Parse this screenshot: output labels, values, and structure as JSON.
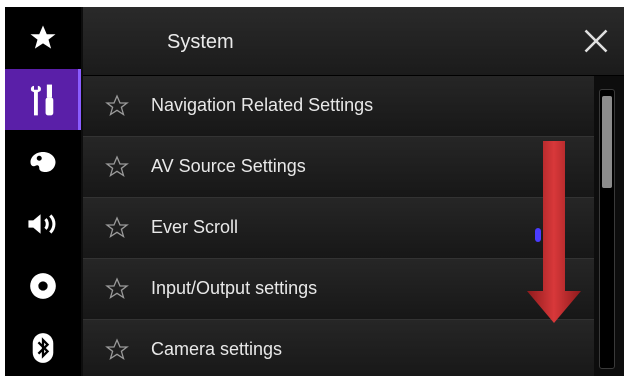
{
  "header": {
    "title": "System"
  },
  "sidebar": {
    "items": [
      {
        "icon": "star-icon"
      },
      {
        "icon": "tools-icon",
        "active": true
      },
      {
        "icon": "palette-icon"
      },
      {
        "icon": "speaker-icon"
      },
      {
        "icon": "disc-icon"
      },
      {
        "icon": "bluetooth-icon"
      }
    ]
  },
  "menu": {
    "items": [
      {
        "label": "Navigation Related Settings"
      },
      {
        "label": "AV Source Settings"
      },
      {
        "label": "Ever Scroll"
      },
      {
        "label": "Input/Output settings"
      },
      {
        "label": "Camera settings"
      }
    ]
  },
  "colors": {
    "active": "#5a1fa8",
    "arrow": "#c0282a"
  }
}
